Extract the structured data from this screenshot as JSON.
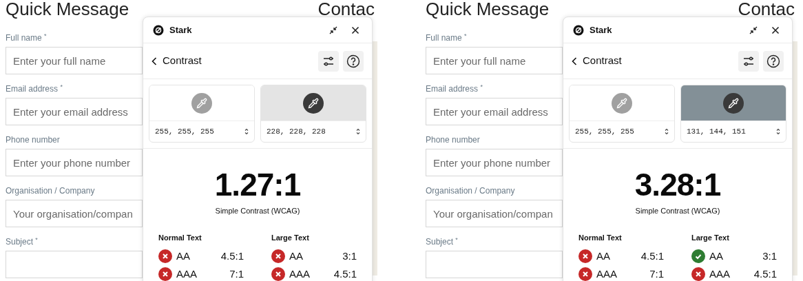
{
  "screens": [
    {
      "form": {
        "title": "Quick Message",
        "side_title": "Contac",
        "fields": [
          {
            "label": "Full name $^{*}$",
            "placeholder": "Enter your full name"
          },
          {
            "label": "Email address $^{*}$",
            "placeholder": "Enter your email address"
          },
          {
            "label": "Phone number",
            "placeholder": "Enter your phone number"
          },
          {
            "label": "Organisation / Company",
            "placeholder": "Your organisation/compan"
          },
          {
            "label": "Subject $^{*}$"
          }
        ]
      },
      "stark": {
        "app_name": "Stark",
        "page_title": "Contrast",
        "colors": [
          {
            "value": "255, 255, 255",
            "color": "#ffffff"
          },
          {
            "value": "228, 228, 228",
            "color": "#e4e4e4"
          }
        ],
        "ratio": "1.27:1",
        "ratio_label": "Simple Contrast (WCAG)",
        "groups": [
          {
            "title": "Normal Text",
            "checks": [
              {
                "grade": "AA",
                "ratio": "4.5:1",
                "pass": false
              },
              {
                "grade": "AAA",
                "ratio": "7:1",
                "pass": false
              }
            ]
          },
          {
            "title": "Large Text",
            "checks": [
              {
                "grade": "AA",
                "ratio": "3:1",
                "pass": false
              },
              {
                "grade": "AAA",
                "ratio": "4.5:1",
                "pass": false
              }
            ]
          }
        ]
      }
    },
    {
      "form": {
        "title": "Quick Message",
        "side_title": "Contac",
        "fields": [
          {
            "label": "Full name $^{*}$",
            "placeholder": "Enter your full name"
          },
          {
            "label": "Email address $^{*}$",
            "placeholder": "Enter your email address"
          },
          {
            "label": "Phone number",
            "placeholder": "Enter your phone number"
          },
          {
            "label": "Organisation / Company",
            "placeholder": "Your organisation/compan"
          },
          {
            "label": "Subject $^{*}$"
          }
        ]
      },
      "stark": {
        "app_name": "Stark",
        "page_title": "Contrast",
        "colors": [
          {
            "value": "255, 255, 255",
            "color": "#ffffff"
          },
          {
            "value": "131, 144, 151",
            "color": "#839097"
          }
        ],
        "ratio": "3.28:1",
        "ratio_label": "Simple Contrast (WCAG)",
        "groups": [
          {
            "title": "Normal Text",
            "checks": [
              {
                "grade": "AA",
                "ratio": "4.5:1",
                "pass": false
              },
              {
                "grade": "AAA",
                "ratio": "7:1",
                "pass": false
              }
            ]
          },
          {
            "title": "Large Text",
            "checks": [
              {
                "grade": "AA",
                "ratio": "3:1",
                "pass": true
              },
              {
                "grade": "AAA",
                "ratio": "4.5:1",
                "pass": false
              }
            ]
          }
        ]
      }
    }
  ]
}
